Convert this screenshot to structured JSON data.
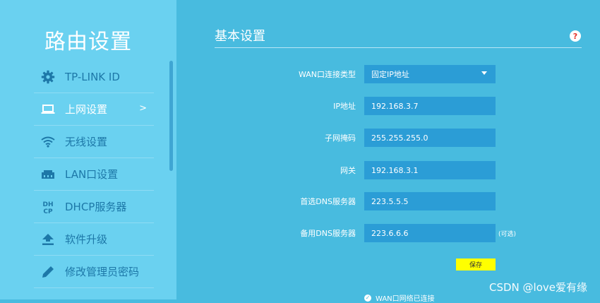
{
  "sidebar": {
    "title": "路由设置",
    "items": [
      {
        "label": "TP-LINK ID",
        "icon": "gear-icon"
      },
      {
        "label": "上网设置",
        "icon": "laptop-icon",
        "active": true,
        "chevron": ">"
      },
      {
        "label": "无线设置",
        "icon": "wifi-icon"
      },
      {
        "label": "LAN口设置",
        "icon": "lan-port-icon"
      },
      {
        "label": "DHCP服务器",
        "icon": "dhcp-icon"
      },
      {
        "label": "软件升级",
        "icon": "upload-icon"
      },
      {
        "label": "修改管理员密码",
        "icon": "pencil-icon"
      }
    ]
  },
  "main": {
    "section_title": "基本设置",
    "help_icon": "?",
    "form": {
      "wan_type": {
        "label": "WAN口连接类型",
        "value": "固定IP地址"
      },
      "ip": {
        "label": "IP地址",
        "value": "192.168.3.7"
      },
      "subnet": {
        "label": "子网掩码",
        "value": "255.255.255.0"
      },
      "gateway": {
        "label": "网关",
        "value": "192.168.3.1"
      },
      "dns1": {
        "label": "首选DNS服务器",
        "value": "223.5.5.5"
      },
      "dns2": {
        "label": "备用DNS服务器",
        "value": "223.6.6.6",
        "note": "(可选)"
      }
    },
    "save_label": "保存",
    "status_text": "WAN口网络已连接"
  },
  "watermark": "CSDN @love爱有缘",
  "colors": {
    "sidebar_bg": "#6ad1f0",
    "main_bg": "#48bbdf",
    "input_bg": "#2b9dd6",
    "save_button": "#ffff00",
    "help_red": "#e5332a"
  }
}
